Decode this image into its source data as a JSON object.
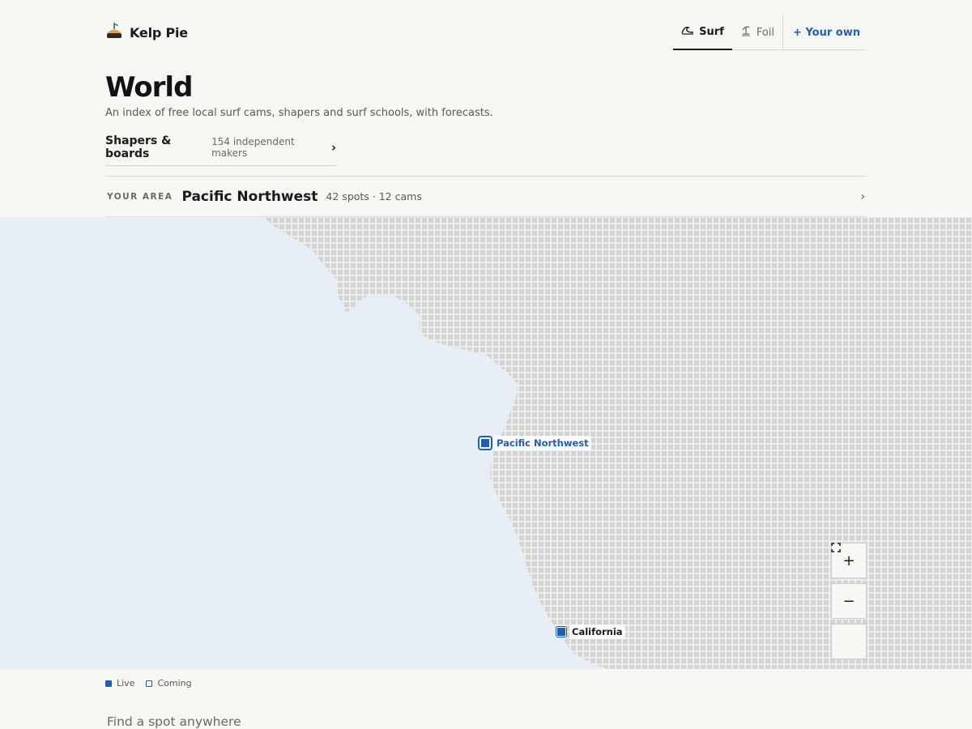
{
  "brand": {
    "name": "Kelp Pie",
    "icon": "kelp-pie-logo"
  },
  "nav": {
    "tabs": [
      {
        "label": "Surf",
        "icon": "surf-wave-icon",
        "active": true
      },
      {
        "label": "Foil",
        "icon": "foil-icon",
        "active": false
      }
    ],
    "own_label": "+ Your own"
  },
  "page": {
    "title": "World",
    "subtitle": "An index of free local surf cams, shapers and surf schools, with forecasts."
  },
  "shapers": {
    "title": "Shapers & boards",
    "count": "154 independent makers",
    "chevron": "›"
  },
  "area": {
    "label": "YOUR AREA",
    "name": "Pacific Northwest",
    "stats": "42 spots · 12 cams",
    "chevron": "›"
  },
  "map": {
    "markers": [
      {
        "label": "Pacific Northwest",
        "status": "live",
        "selected": true
      },
      {
        "label": "California",
        "status": "live",
        "selected": false
      }
    ],
    "controls": {
      "zoom_in": "+",
      "zoom_out": "−",
      "fullscreen": "⛶"
    },
    "colors": {
      "water": "#e8eef5",
      "land_dot": "#d6d2cc",
      "accent": "#1d5fb8"
    }
  },
  "legend": {
    "live": "Live",
    "coming": "Coming"
  },
  "search": {
    "placeholder": "Find a spot anywhere"
  }
}
